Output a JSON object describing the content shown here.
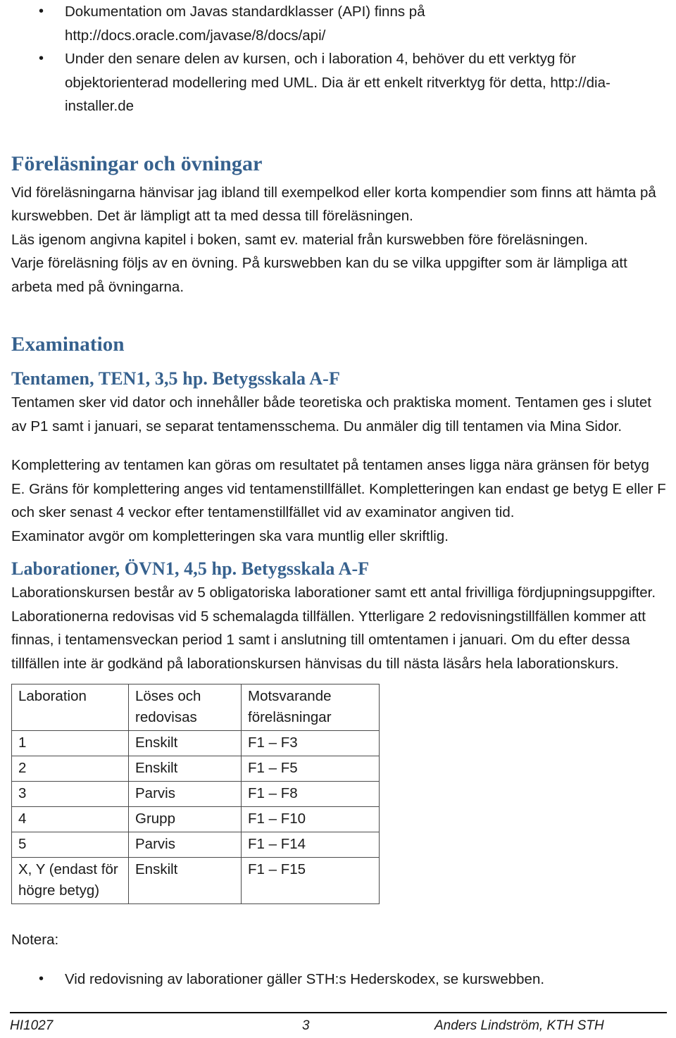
{
  "document": {
    "page_number": "3",
    "course_code": "HI1027",
    "author": "Anders Lindström, KTH STH"
  },
  "theme": {
    "heading_color": "#36618E",
    "body_color": "#1A1A1A",
    "table_border_color": "#4A4A4A",
    "background": "#FFFFFF"
  },
  "top_bullets": [
    "Dokumentation om Javas standardklasser (API) finns på http://docs.oracle.com/javase/8/docs/api/",
    "Under den senare delen av kursen, och i laboration 4, behöver du ett verktyg för objektorienterad modellering med UML. Dia är ett enkelt ritverktyg för detta, http://dia-installer.de"
  ],
  "lectures_section": {
    "heading": "Föreläsningar och övningar",
    "paragraphs": [
      "Vid föreläsningarna hänvisar jag ibland till exempelkod eller korta kompendier som finns att hämta på kurswebben. Det är lämpligt att ta med dessa till föreläsningen.",
      "Läs igenom angivna kapitel i boken, samt ev. material från kurswebben före föreläsningen.",
      "Varje föreläsning följs av en övning. På kurswebben kan du se vilka uppgifter som är lämpliga att arbeta med på övningarna."
    ]
  },
  "examination_section": {
    "heading": "Examination",
    "exam": {
      "heading": "Tentamen, TEN1, 3,5 hp. Betygsskala A-F",
      "paragraphs": [
        "Tentamen sker vid dator och innehåller både teoretiska och praktiska moment. Tentamen ges i slutet av P1 samt i januari, se separat tentamensschema. Du anmäler dig till tentamen via Mina Sidor.",
        "Komplettering av tentamen kan göras om resultatet på tentamen anses ligga nära gränsen för betyg E. Gräns för komplettering anges vid tentamenstillfället. Kompletteringen kan endast ge betyg E eller F och sker senast 4 veckor efter tentamenstillfället vid av examinator angiven tid.",
        "Examinator avgör om kompletteringen ska vara muntlig eller skriftlig."
      ]
    },
    "labs": {
      "heading": "Laborationer, ÖVN1, 4,5 hp. Betygsskala A-F",
      "paragraphs": [
        "Laborationskursen består av 5 obligatoriska laborationer samt ett antal frivilliga fördjupningsuppgifter.",
        "Laborationerna redovisas vid 5 schemalagda tillfällen. Ytterligare 2 redovisningstillfällen kommer att finnas, i tentamensveckan period 1 samt i anslutning till omtentamen i januari. Om du efter dessa tillfällen inte är godkänd på laborationskursen hänvisas du till nästa läsårs hela laborationskurs."
      ],
      "table": {
        "headers": [
          "Laboration",
          "Löses och redovisas",
          "Motsvarande föreläsningar"
        ],
        "rows": [
          [
            "1",
            "Enskilt",
            "F1 – F3"
          ],
          [
            "2",
            "Enskilt",
            "F1 – F5"
          ],
          [
            "3",
            "Parvis",
            "F1 – F8"
          ],
          [
            "4",
            "Grupp",
            "F1 – F10"
          ],
          [
            "5",
            "Parvis",
            "F1 – F14"
          ],
          [
            "X, Y (endast för högre betyg)",
            "Enskilt",
            "F1 – F15"
          ]
        ]
      }
    }
  },
  "notes_section": {
    "label": "Notera:",
    "bullets": [
      "Vid redovisning av laborationer gäller STH:s Hederskodex, se kurswebben."
    ]
  }
}
